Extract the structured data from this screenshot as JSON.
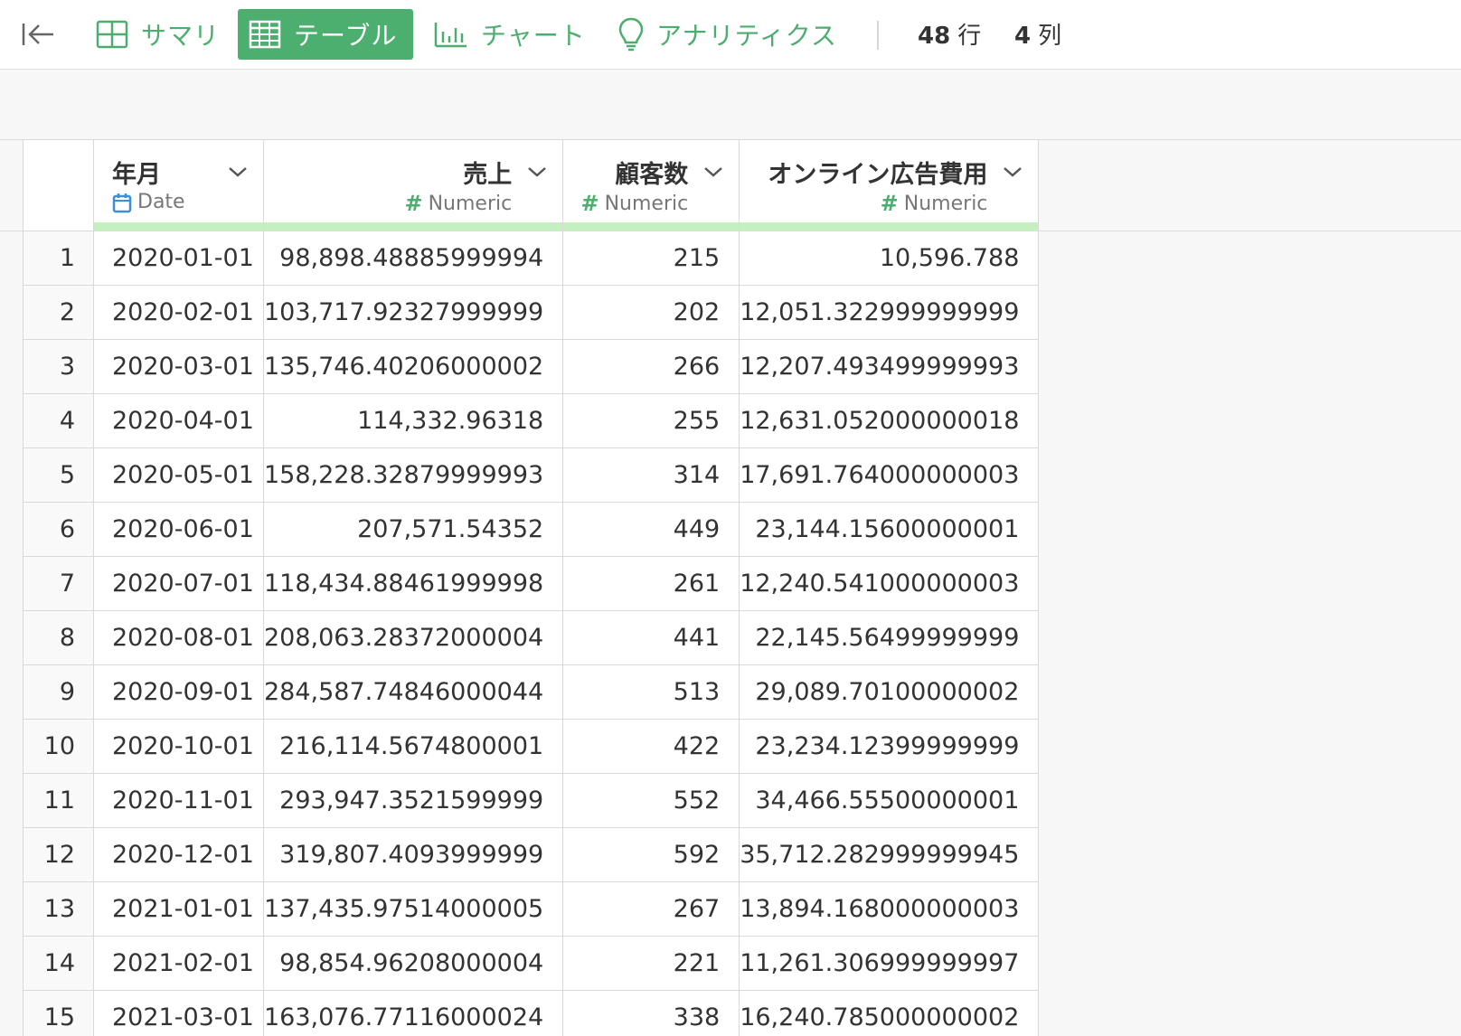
{
  "toolbar": {
    "tabs": [
      {
        "label": "サマリ",
        "icon": "summary-grid-icon"
      },
      {
        "label": "テーブル",
        "icon": "table-icon",
        "active": true
      },
      {
        "label": "チャート",
        "icon": "bar-chart-icon"
      },
      {
        "label": "アナリティクス",
        "icon": "lightbulb-icon"
      }
    ],
    "row_count": "48",
    "row_unit": "行",
    "col_count": "4",
    "col_unit": "列",
    "accent": "#4caf6f"
  },
  "table": {
    "columns": [
      {
        "name": "年月",
        "type": "Date"
      },
      {
        "name": "売上",
        "type": "Numeric"
      },
      {
        "name": "顧客数",
        "type": "Numeric"
      },
      {
        "name": "オンライン広告費用",
        "type": "Numeric"
      }
    ],
    "rows": [
      [
        "1",
        "2020-01-01",
        "98,898.48885999994",
        "215",
        "10,596.788"
      ],
      [
        "2",
        "2020-02-01",
        "103,717.92327999999",
        "202",
        "12,051.322999999999"
      ],
      [
        "3",
        "2020-03-01",
        "135,746.40206000002",
        "266",
        "12,207.493499999993"
      ],
      [
        "4",
        "2020-04-01",
        "114,332.96318",
        "255",
        "12,631.052000000018"
      ],
      [
        "5",
        "2020-05-01",
        "158,228.32879999993",
        "314",
        "17,691.764000000003"
      ],
      [
        "6",
        "2020-06-01",
        "207,571.54352",
        "449",
        "23,144.15600000001"
      ],
      [
        "7",
        "2020-07-01",
        "118,434.88461999998",
        "261",
        "12,240.541000000003"
      ],
      [
        "8",
        "2020-08-01",
        "208,063.28372000004",
        "441",
        "22,145.56499999999"
      ],
      [
        "9",
        "2020-09-01",
        "284,587.74846000044",
        "513",
        "29,089.70100000002"
      ],
      [
        "10",
        "2020-10-01",
        "216,114.5674800001",
        "422",
        "23,234.12399999999"
      ],
      [
        "11",
        "2020-11-01",
        "293,947.3521599999",
        "552",
        "34,466.55500000001"
      ],
      [
        "12",
        "2020-12-01",
        "319,807.4093999999",
        "592",
        "35,712.282999999945"
      ],
      [
        "13",
        "2021-01-01",
        "137,435.97514000005",
        "267",
        "13,894.168000000003"
      ],
      [
        "14",
        "2021-02-01",
        "98,854.96208000004",
        "221",
        "11,261.306999999997"
      ],
      [
        "15",
        "2021-03-01",
        "163,076.77116000024",
        "338",
        "16,240.785000000002"
      ]
    ]
  }
}
